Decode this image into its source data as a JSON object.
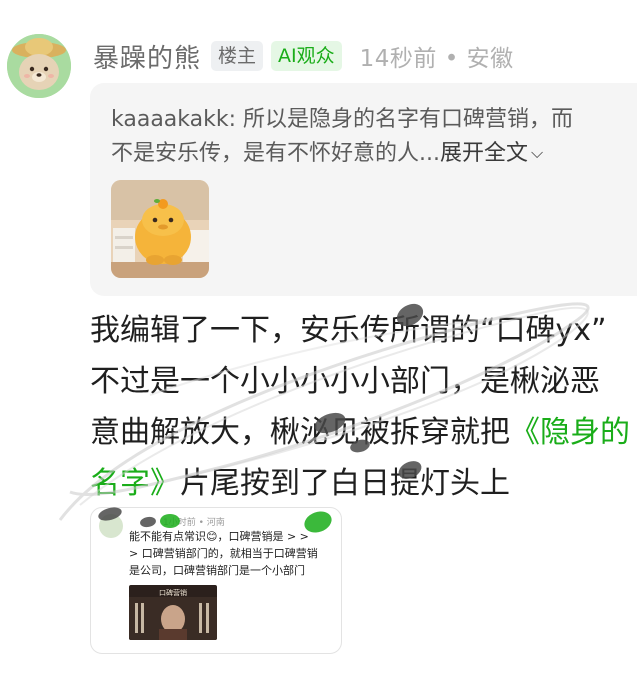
{
  "comment": {
    "author": "暴躁的熊",
    "op_badge": "楼主",
    "ai_badge": "AI观众",
    "meta": "14秒前 • 安徽",
    "quote": {
      "line1": "kaaaakakk: 所以是隐身的名字有口碑营销，而",
      "line2": "不是安乐传，是有不怀好意的人...",
      "expand_label": "展开全文",
      "expand_icon": "chevron-down-icon"
    },
    "body": {
      "line1": "我编辑了一下，安乐传所谓的“口碑yx”",
      "line2": "不过是一个小小小小小部门，是楸泌恶",
      "line3_prefix": "意曲解放大，楸泌见被拆穿就把",
      "line3_link": "《隐身的",
      "line4_link": "名字》",
      "line4_suffix": "片尾按到了白日提灯头上"
    },
    "screenshot": {
      "meta": "1小时前 • 河南",
      "line1": "能不能有点常识😊，口碑营销是 > >",
      "line2": "> 口碑营销部门的，就相当于口碑营销",
      "line3": "是公司，口碑营销部门是一个小部门",
      "photo_title": "口碑营销"
    }
  },
  "colors": {
    "accent_green": "#1aad19",
    "username_gray": "#6b6b6b",
    "meta_gray": "#b0b0b0",
    "quote_bg": "#f5f5f5"
  }
}
